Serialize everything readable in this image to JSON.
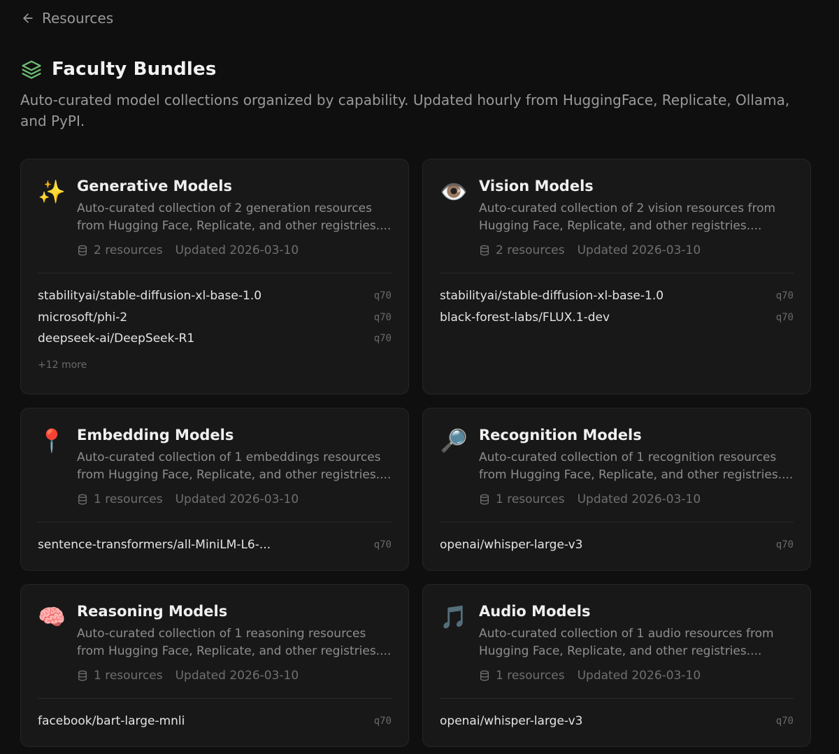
{
  "nav": {
    "back_label": "Resources"
  },
  "page": {
    "title": "Faculty Bundles",
    "description": "Auto-curated model collections organized by capability. Updated hourly from HuggingFace, Replicate, Ollama, and PyPI."
  },
  "bundles": [
    {
      "icon": "✨",
      "title": "Generative Models",
      "description": "Auto-curated collection of 2 generation resources from Hugging Face, Replicate, and other registries....",
      "resources_label": "2 resources",
      "updated_label": "Updated 2026-03-10",
      "resources": [
        {
          "name": "stabilityai/stable-diffusion-xl-base-1.0",
          "quality": "q70"
        },
        {
          "name": "microsoft/phi-2",
          "quality": "q70"
        },
        {
          "name": "deepseek-ai/DeepSeek-R1",
          "quality": "q70"
        }
      ],
      "more_label": "+12 more"
    },
    {
      "icon": "👁️",
      "title": "Vision Models",
      "description": "Auto-curated collection of 2 vision resources from Hugging Face, Replicate, and other registries....",
      "resources_label": "2 resources",
      "updated_label": "Updated 2026-03-10",
      "resources": [
        {
          "name": "stabilityai/stable-diffusion-xl-base-1.0",
          "quality": "q70"
        },
        {
          "name": "black-forest-labs/FLUX.1-dev",
          "quality": "q70"
        }
      ]
    },
    {
      "icon": "📍",
      "title": "Embedding Models",
      "description": "Auto-curated collection of 1 embeddings resources from Hugging Face, Replicate, and other registries....",
      "resources_label": "1 resources",
      "updated_label": "Updated 2026-03-10",
      "resources": [
        {
          "name": "sentence-transformers/all-MiniLM-L6-...",
          "quality": "q70"
        }
      ]
    },
    {
      "icon": "🔎",
      "title": "Recognition Models",
      "description": "Auto-curated collection of 1 recognition resources from Hugging Face, Replicate, and other registries....",
      "resources_label": "1 resources",
      "updated_label": "Updated 2026-03-10",
      "resources": [
        {
          "name": "openai/whisper-large-v3",
          "quality": "q70"
        }
      ]
    },
    {
      "icon": "🧠",
      "title": "Reasoning Models",
      "description": "Auto-curated collection of 1 reasoning resources from Hugging Face, Replicate, and other registries....",
      "resources_label": "1 resources",
      "updated_label": "Updated 2026-03-10",
      "resources": [
        {
          "name": "facebook/bart-large-mnli",
          "quality": "q70"
        }
      ]
    },
    {
      "icon": "🎵",
      "title": "Audio Models",
      "description": "Auto-curated collection of 1 audio resources from Hugging Face, Replicate, and other registries....",
      "resources_label": "1 resources",
      "updated_label": "Updated 2026-03-10",
      "resources": [
        {
          "name": "openai/whisper-large-v3",
          "quality": "q70"
        }
      ]
    }
  ]
}
